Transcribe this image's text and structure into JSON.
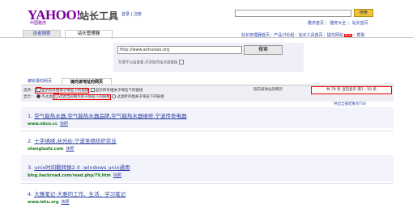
{
  "header": {
    "logo_text": "YAHOO!",
    "logo_sub": "中国雅虎",
    "site_title": "站长工具",
    "login": "登录",
    "register": "注册",
    "search_button": "搜索",
    "right_links": [
      "雅虎首页",
      "雅虎大全",
      "站长首页"
    ]
  },
  "tabs": {
    "tab1": "这者搜索",
    "tab2": "站长管理器"
  },
  "nav_links": [
    "站长管理器首页",
    "产品讨论组",
    "站长工具首页",
    "提交网站",
    "帮助"
  ],
  "search": {
    "url_value": "http://www.anhuiseo.org",
    "button": "搜索",
    "hint": "为便于以后查看,可添加的站点或链接"
  },
  "result_tabs": {
    "tab1": "被收录的网页",
    "tab2": "链向该地址的网页"
  },
  "filters": {
    "row1_label": "选项：",
    "row1_opt1": "显示所有相关子域名下的链接",
    "row1_opt2": "显示所有相关子域名下的链接",
    "row2_label": "显示：",
    "row2_opt1": "不过滤",
    "row2_opt2": "过滤当前网页的子域名下的链接",
    "row2_opt3": "过滤所有相关子域名下的链接",
    "redirect_label": "链向该地址的网页",
    "count_text": "共 79 条 当前显示 第1 - 50 条",
    "export": "导出全部结果为TSV"
  },
  "results": [
    {
      "num": "1.",
      "title": "空气能热水器,空气能热水器品牌,空气能热水器维修,宁波传奇电器",
      "url": "www.nbcn.cc",
      "cache": "快照"
    },
    {
      "num": "2.",
      "title": "十字绣绣,丝光纱,宁波圣德纺织实业",
      "url": "shengluofz.com",
      "cache": "快照"
    },
    {
      "num": "3.",
      "title": "unix时间戳转换2.0 -windows unix通用",
      "url": "blog.hackroad.com/read.php/79.htm",
      "cache": "快照"
    },
    {
      "num": "4.",
      "title": "大雅笔记-大雅的工作、生活、学习笔记",
      "url": "www.izhu.org",
      "cache": "快照"
    }
  ],
  "colors": {
    "brand": "#7b0099",
    "link": "#2a3fa0",
    "url_green": "#1a7a1a",
    "search_button_yellow": "#f0c33c",
    "highlight_red": "#e00000"
  }
}
